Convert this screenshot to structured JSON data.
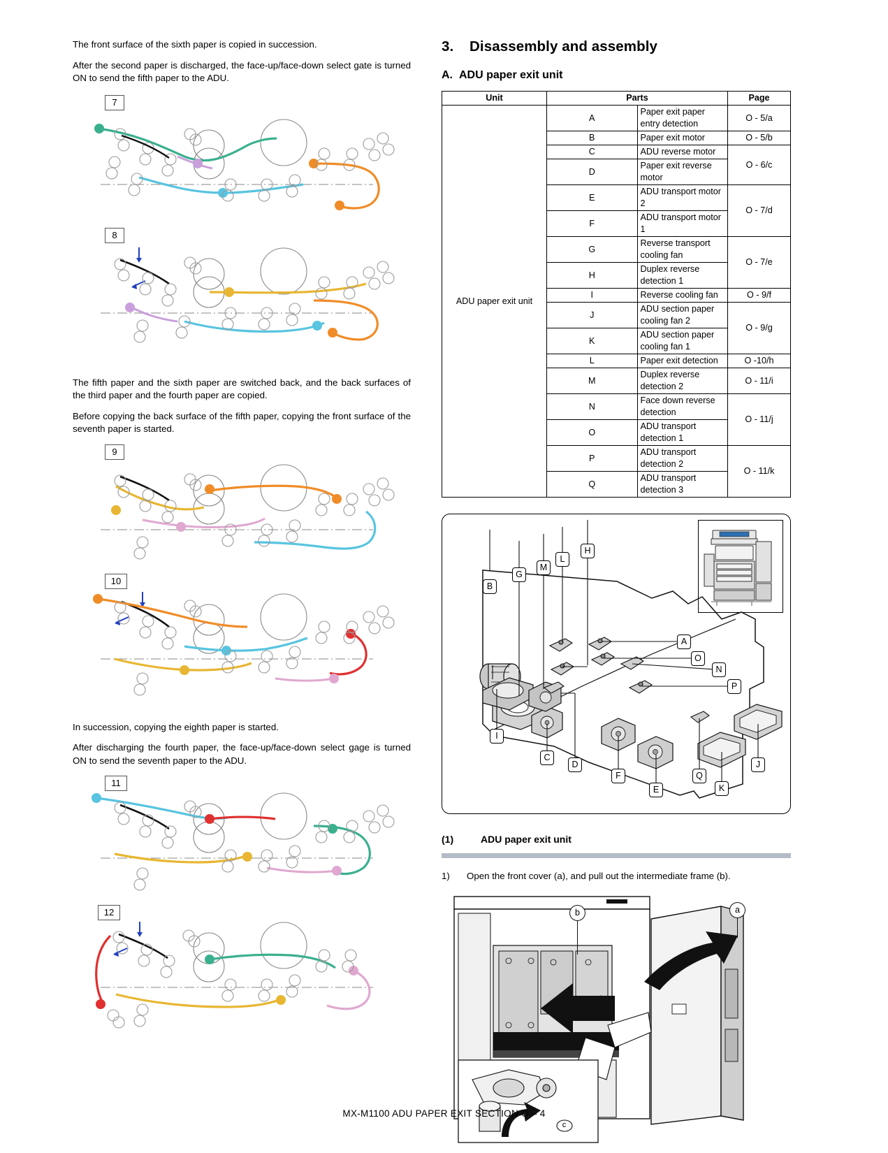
{
  "document": {
    "footer": "MX-M1100  ADU PAPER EXIT SECTION  O – 4"
  },
  "left_column": {
    "paragraphs_1": [
      "The front surface of the sixth paper is copied in succession.",
      "After the second paper is discharged, the face-up/face-down select gate is turned ON to send the fifth paper to the ADU."
    ],
    "paragraphs_2": [
      "The fifth paper and the sixth paper are switched back, and the back surfaces of the third paper and the fourth paper are copied.",
      "Before copying the back surface of the fifth paper, copying the front surface of the seventh paper is started."
    ],
    "paragraphs_3": [
      "In succession, copying the eighth paper is started.",
      "After discharging the fourth paper, the face-up/face-down select gage is turned ON to send the seventh paper to the ADU."
    ],
    "figure_numbers": [
      "7",
      "8",
      "9",
      "10",
      "11",
      "12"
    ]
  },
  "right_column": {
    "section_number": "3.",
    "section_title": "Disassembly and assembly",
    "subsection_letter": "A.",
    "subsection_title": "ADU paper exit unit",
    "table": {
      "headers": {
        "unit": "Unit",
        "parts": "Parts",
        "page": "Page"
      },
      "unit_name": "ADU paper exit unit",
      "rows": [
        {
          "letter": "A",
          "part": "Paper exit paper entry detection",
          "page": "O - 5/a",
          "page_span": 1
        },
        {
          "letter": "B",
          "part": "Paper exit motor",
          "page": "O - 5/b",
          "page_span": 1
        },
        {
          "letter": "C",
          "part": "ADU reverse motor",
          "page": "O - 6/c",
          "page_span": 2
        },
        {
          "letter": "D",
          "part": "Paper exit reverse motor",
          "page": "",
          "page_span": 0
        },
        {
          "letter": "E",
          "part": "ADU transport motor 2",
          "page": "O - 7/d",
          "page_span": 2
        },
        {
          "letter": "F",
          "part": "ADU transport motor 1",
          "page": "",
          "page_span": 0
        },
        {
          "letter": "G",
          "part": "Reverse transport cooling fan",
          "page": "O - 7/e",
          "page_span": 2
        },
        {
          "letter": "H",
          "part": "Duplex reverse detection 1",
          "page": "",
          "page_span": 0
        },
        {
          "letter": "I",
          "part": "Reverse cooling fan",
          "page": "O - 9/f",
          "page_span": 1
        },
        {
          "letter": "J",
          "part": "ADU section paper cooling fan 2",
          "page": "O - 9/g",
          "page_span": 2
        },
        {
          "letter": "K",
          "part": "ADU section paper cooling fan 1",
          "page": "",
          "page_span": 0
        },
        {
          "letter": "L",
          "part": "Paper exit detection",
          "page": "O -10/h",
          "page_span": 1
        },
        {
          "letter": "M",
          "part": "Duplex reverse detection 2",
          "page": "O - 11/i",
          "page_span": 1
        },
        {
          "letter": "N",
          "part": "Face down reverse detection",
          "page": "O - 11/j",
          "page_span": 2
        },
        {
          "letter": "O",
          "part": "ADU transport detection 1",
          "page": "",
          "page_span": 0
        },
        {
          "letter": "P",
          "part": "ADU transport detection 2",
          "page": "O - 11/k",
          "page_span": 2
        },
        {
          "letter": "Q",
          "part": "ADU transport detection 3",
          "page": "",
          "page_span": 0
        }
      ]
    },
    "diagram_callouts": [
      "A",
      "B",
      "C",
      "D",
      "E",
      "F",
      "G",
      "H",
      "I",
      "J",
      "K",
      "L",
      "M",
      "N",
      "O",
      "P",
      "Q"
    ],
    "procedure": {
      "number": "(1)",
      "title": "ADU paper exit unit",
      "steps": [
        {
          "n": "1)",
          "text": "Open the front cover (a), and pull out the intermediate frame (b)."
        }
      ],
      "photo_callouts": [
        "a",
        "b",
        "c"
      ]
    }
  },
  "colors": {
    "grey_bar": "#b3bcc6",
    "path_green": "#3bb08f",
    "path_orange": "#f08c28",
    "path_blue": "#58c4e0",
    "path_purple": "#c9a0dc",
    "path_yellow": "#e8b632",
    "path_red": "#e03030",
    "path_pink": "#e0a8d0",
    "machine_grey": "#d6d6d6"
  }
}
